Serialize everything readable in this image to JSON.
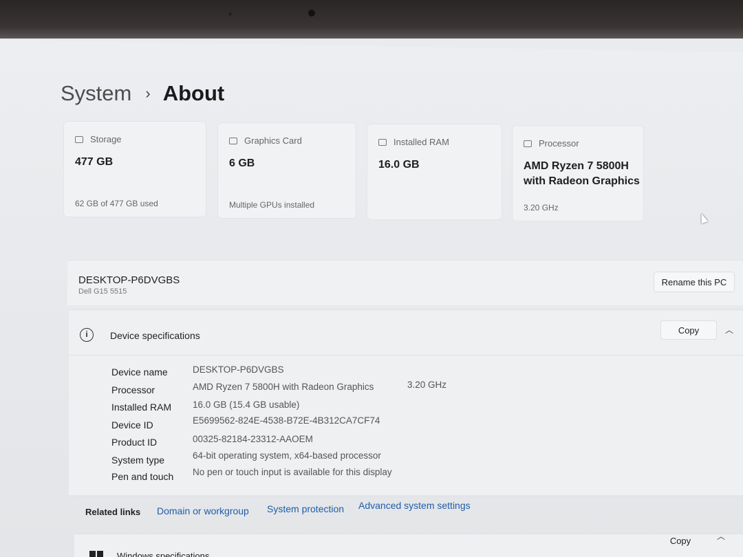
{
  "breadcrumb": {
    "parent": "System",
    "separator": "›",
    "current": "About"
  },
  "cards": [
    {
      "icon": "storage-icon",
      "label": "Storage",
      "value": "477 GB",
      "sub": "62 GB of 477 GB used"
    },
    {
      "icon": "graphics-card-icon",
      "label": "Graphics Card",
      "value": "6 GB",
      "sub": "Multiple GPUs installed"
    },
    {
      "icon": "ram-icon",
      "label": "Installed RAM",
      "value": "16.0 GB",
      "sub": ""
    },
    {
      "icon": "processor-icon",
      "label": "Processor",
      "value": "AMD Ryzen 7 5800H with Radeon Graphics",
      "sub": "3.20 GHz"
    }
  ],
  "pc": {
    "name": "DESKTOP-P6DVGBS",
    "model": "Dell G15 5515",
    "rename_label": "Rename this PC"
  },
  "device_specs": {
    "title": "Device specifications",
    "copy_label": "Copy",
    "rows": [
      {
        "label": "Device name",
        "value": "DESKTOP-P6DVGBS",
        "extra": ""
      },
      {
        "label": "Processor",
        "value": "AMD Ryzen 7 5800H with Radeon Graphics",
        "extra": "3.20 GHz"
      },
      {
        "label": "Installed RAM",
        "value": "16.0 GB (15.4 GB usable)",
        "extra": ""
      },
      {
        "label": "Device ID",
        "value": "E5699562-824E-4538-B72E-4B312CA7CF74",
        "extra": ""
      },
      {
        "label": "Product ID",
        "value": "00325-82184-23312-AAOEM",
        "extra": ""
      },
      {
        "label": "System type",
        "value": "64-bit operating system, x64-based processor",
        "extra": ""
      },
      {
        "label": "Pen and touch",
        "value": "No pen or touch input is available for this display",
        "extra": ""
      }
    ]
  },
  "related": {
    "label": "Related links",
    "links": [
      "Domain or workgroup",
      "System protection",
      "Advanced system settings"
    ]
  },
  "windows_specs": {
    "title": "Windows specifications",
    "copy_label": "Copy"
  }
}
